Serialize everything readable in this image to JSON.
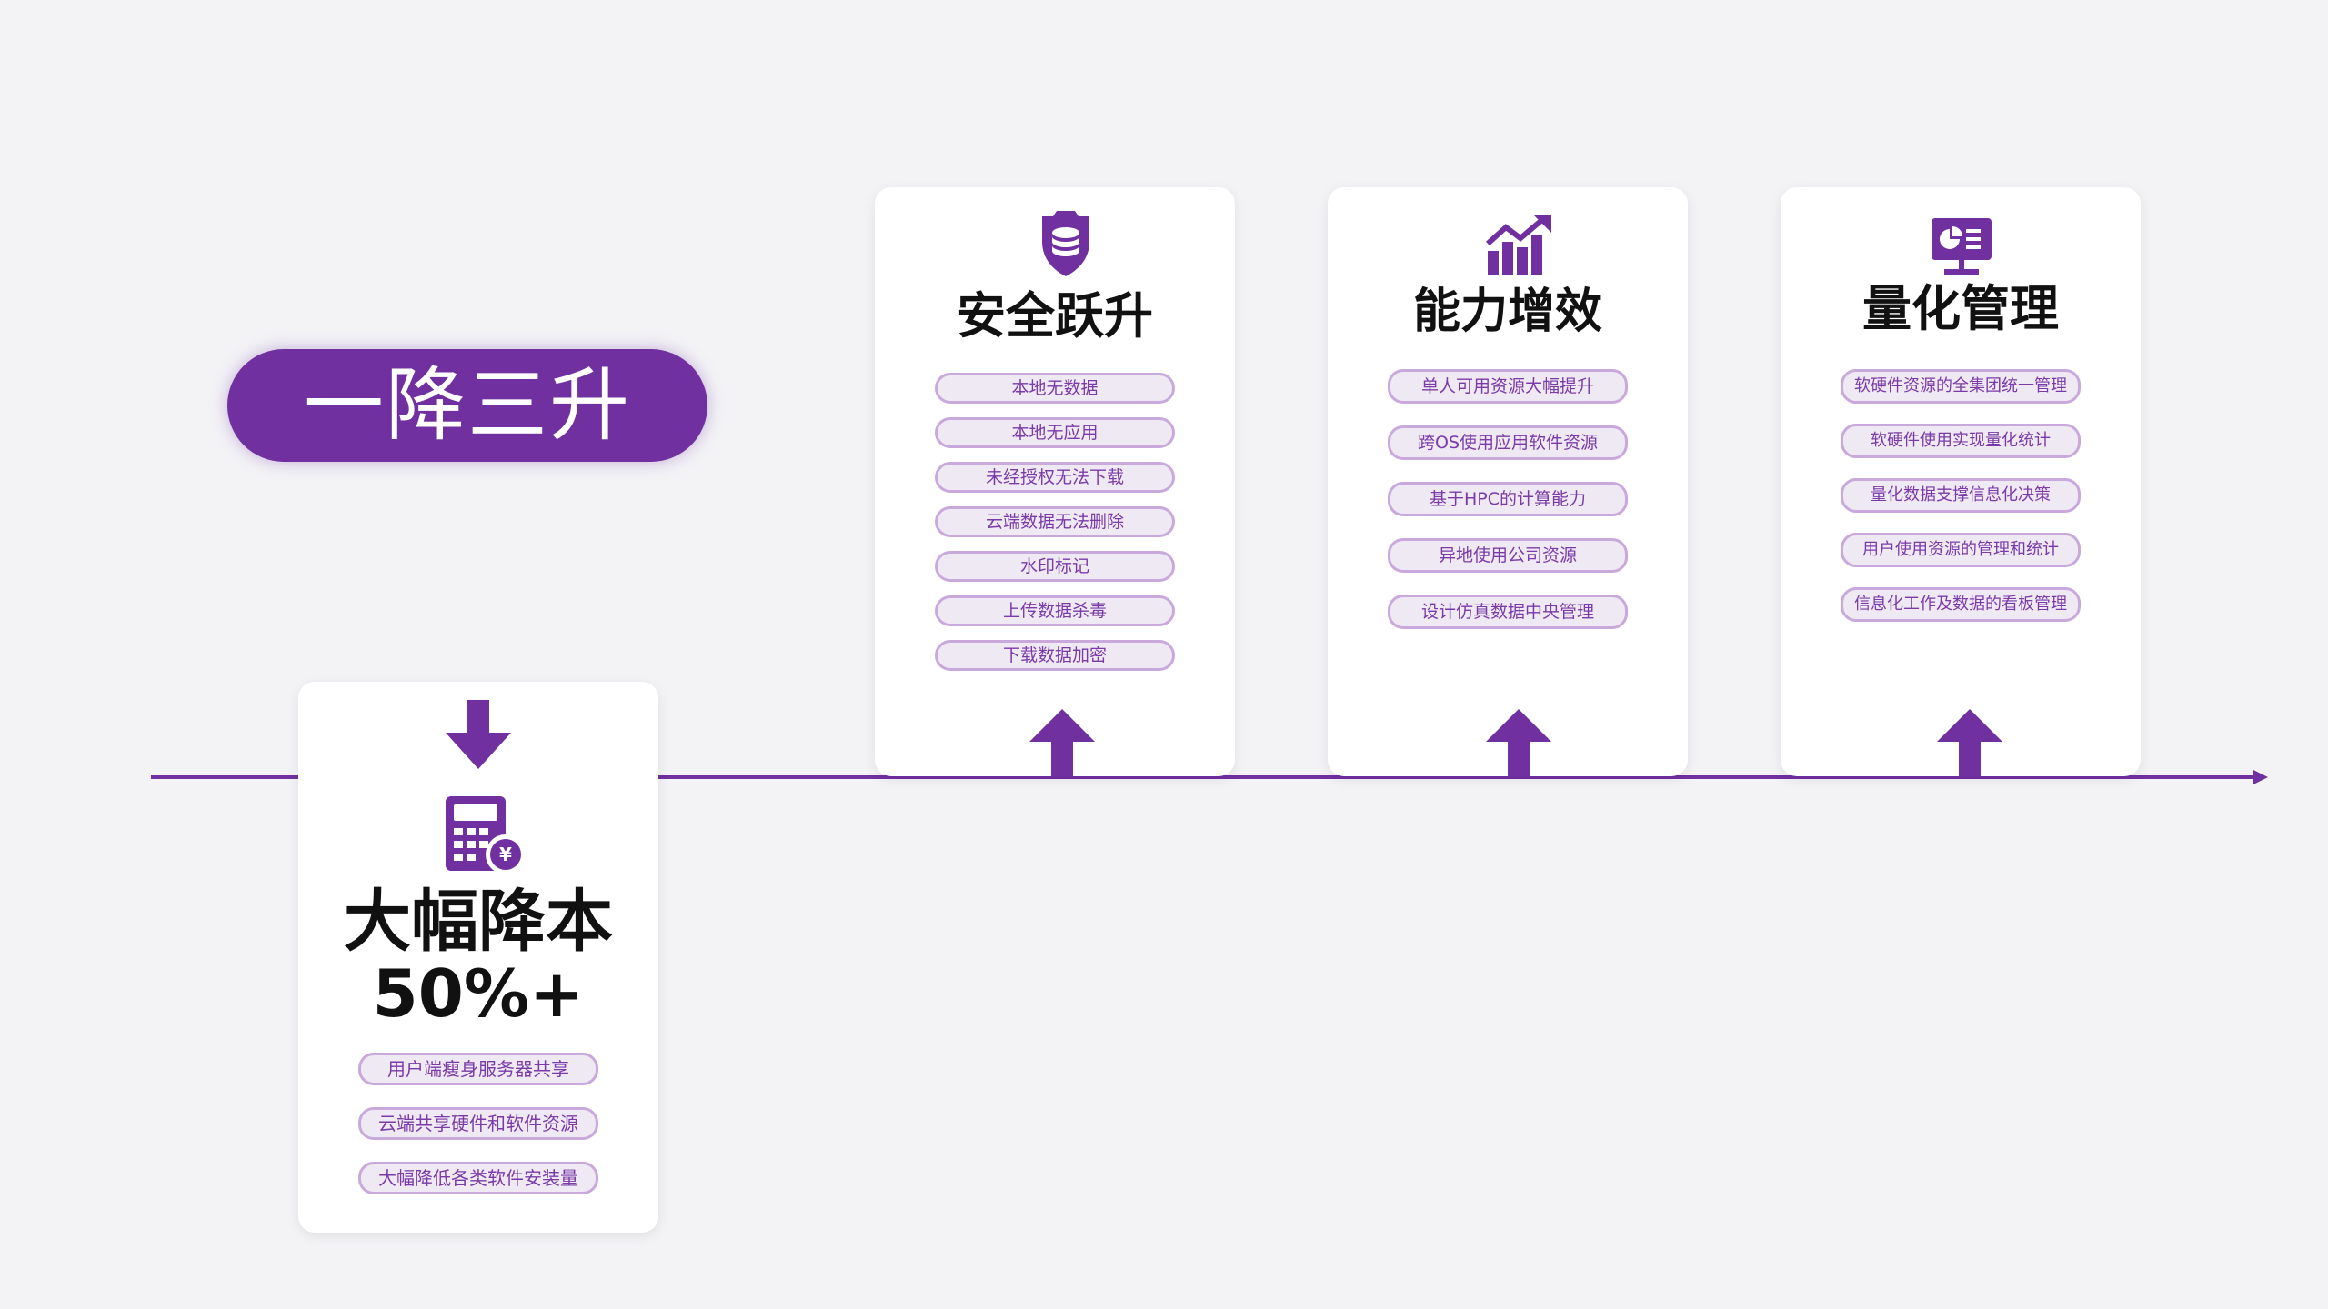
{
  "main_title": "一降三升",
  "colors": {
    "accent": "#7030a0",
    "tag_fill": "#eee9f3",
    "tag_border": "#c9a9dc",
    "tag_text": "#7a3aa8",
    "background": "#f3f3f6"
  },
  "cost_card": {
    "icon": "calculator-yen-icon",
    "arrow": "down-arrow-icon",
    "title_line1": "大幅降本",
    "title_line2": "50%+",
    "tags": [
      "用户端瘦身服务器共享",
      "云端共享硬件和软件资源",
      "大幅降低各类软件安装量"
    ]
  },
  "security_card": {
    "icon": "shield-database-icon",
    "arrow": "up-arrow-icon",
    "title": "安全跃升",
    "tags": [
      "本地无数据",
      "本地无应用",
      "未经授权无法下载",
      "云端数据无法删除",
      "水印标记",
      "上传数据杀毒",
      "下载数据加密"
    ]
  },
  "capability_card": {
    "icon": "bar-chart-trend-icon",
    "arrow": "up-arrow-icon",
    "title": "能力增效",
    "tags": [
      "单人可用资源大幅提升",
      "跨OS使用应用软件资源",
      "基于HPC的计算能力",
      "异地使用公司资源",
      "设计仿真数据中央管理"
    ]
  },
  "management_card": {
    "icon": "presentation-board-icon",
    "arrow": "up-arrow-icon",
    "title": "量化管理",
    "tags": [
      "软硬件资源的全集团统一管理",
      "软硬件使用实现量化统计",
      "量化数据支撑信息化决策",
      "用户使用资源的管理和统计",
      "信息化工作及数据的看板管理"
    ]
  }
}
